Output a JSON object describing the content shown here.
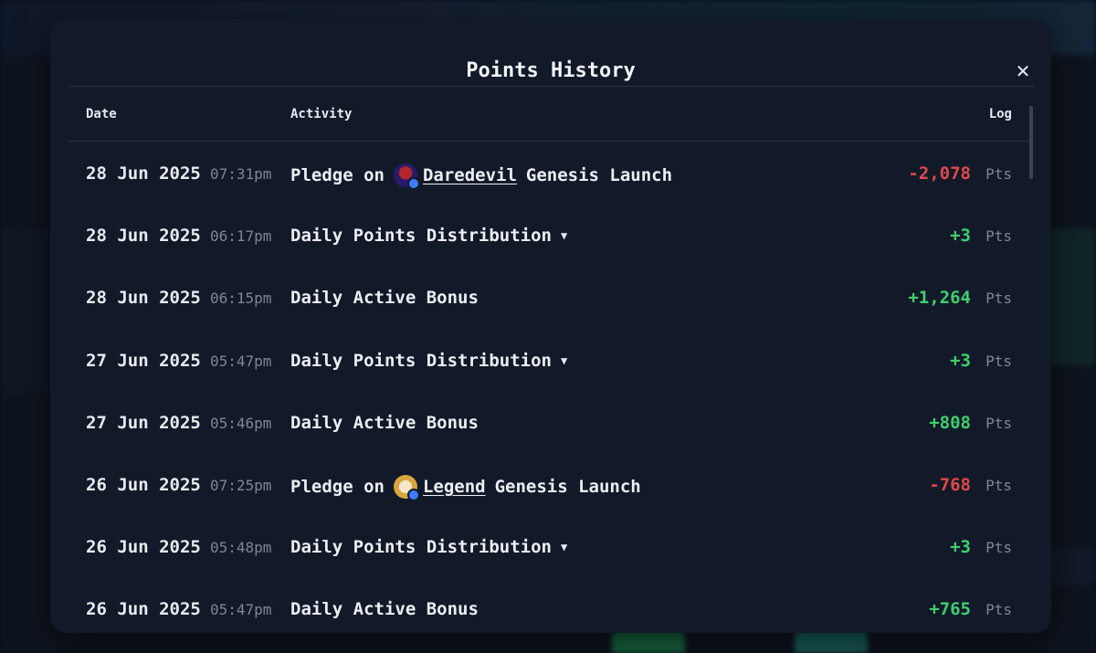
{
  "modal": {
    "title": "Points History",
    "close_icon": "close-icon"
  },
  "columns": {
    "date": "Date",
    "activity": "Activity",
    "log": "Log"
  },
  "colors": {
    "negative": "#e0484a",
    "positive": "#3ecf6e",
    "muted": "#7d8697"
  },
  "rows": [
    {
      "date": "28 Jun 2025",
      "time": "07:31pm",
      "prefix": "Pledge on",
      "token": "Daredevil",
      "suffix": "Genesis Launch",
      "log": "-2,078",
      "unit": "Pts",
      "sign": "neg",
      "avatar": "daredevil-avatar"
    },
    {
      "date": "28 Jun 2025",
      "time": "06:17pm",
      "activity": "Daily Points Distribution",
      "expandable": true,
      "log": "+3",
      "unit": "Pts",
      "sign": "pos"
    },
    {
      "date": "28 Jun 2025",
      "time": "06:15pm",
      "activity": "Daily Active Bonus",
      "log": "+1,264",
      "unit": "Pts",
      "sign": "pos"
    },
    {
      "date": "27 Jun 2025",
      "time": "05:47pm",
      "activity": "Daily Points Distribution",
      "expandable": true,
      "log": "+3",
      "unit": "Pts",
      "sign": "pos"
    },
    {
      "date": "27 Jun 2025",
      "time": "05:46pm",
      "activity": "Daily Active Bonus",
      "log": "+808",
      "unit": "Pts",
      "sign": "pos"
    },
    {
      "date": "26 Jun 2025",
      "time": "07:25pm",
      "prefix": "Pledge on",
      "token": "Legend",
      "suffix": "Genesis Launch",
      "log": "-768",
      "unit": "Pts",
      "sign": "neg",
      "avatar": "legend-avatar"
    },
    {
      "date": "26 Jun 2025",
      "time": "05:48pm",
      "activity": "Daily Points Distribution",
      "expandable": true,
      "log": "+3",
      "unit": "Pts",
      "sign": "pos"
    },
    {
      "date": "26 Jun 2025",
      "time": "05:47pm",
      "activity": "Daily Active Bonus",
      "log": "+765",
      "unit": "Pts",
      "sign": "pos"
    }
  ]
}
